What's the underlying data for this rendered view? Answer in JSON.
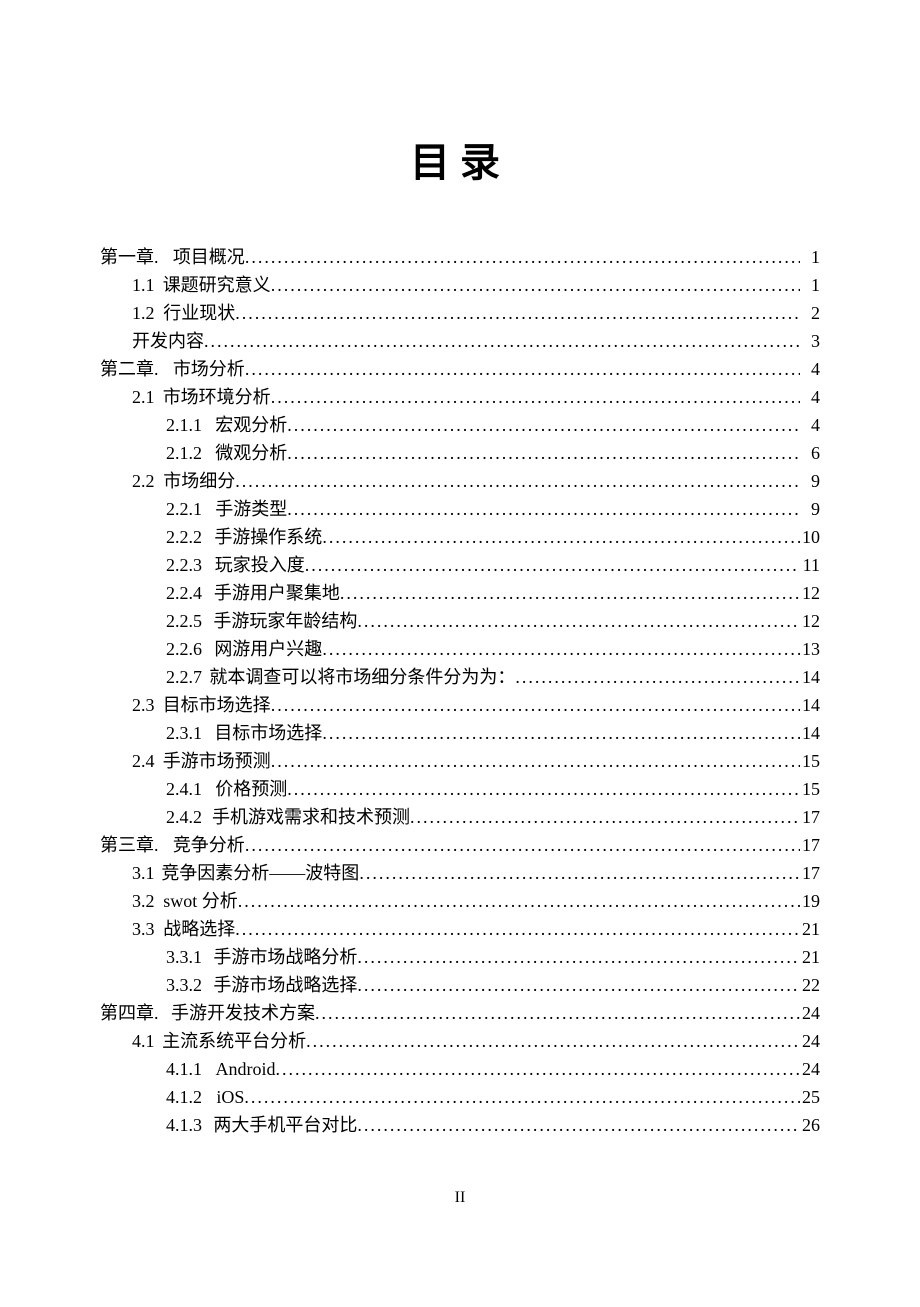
{
  "title": "目录",
  "footer": "II",
  "toc": [
    {
      "level": 0,
      "num": "第一章.",
      "label": "项目概况",
      "page": "1"
    },
    {
      "level": 1,
      "num": "1.1",
      "label": "课题研究意义",
      "page": "1"
    },
    {
      "level": 1,
      "num": "1.2",
      "label": "行业现状",
      "page": "2"
    },
    {
      "level": 1,
      "num": "",
      "label": "开发内容",
      "page": "3"
    },
    {
      "level": 0,
      "num": "第二章.",
      "label": "市场分析",
      "page": "4"
    },
    {
      "level": 1,
      "num": "2.1",
      "label": "市场环境分析",
      "page": "4"
    },
    {
      "level": 2,
      "num": "2.1.1",
      "label": "宏观分析",
      "page": "4"
    },
    {
      "level": 2,
      "num": "2.1.2",
      "label": "微观分析",
      "page": "6"
    },
    {
      "level": 1,
      "num": "2.2",
      "label": "市场细分",
      "page": "9"
    },
    {
      "level": 2,
      "num": "2.2.1",
      "label": "手游类型",
      "page": "9"
    },
    {
      "level": 2,
      "num": "2.2.2",
      "label": "手游操作系统",
      "page": "10"
    },
    {
      "level": 2,
      "num": "2.2.3",
      "label": "玩家投入度",
      "page": "11"
    },
    {
      "level": 2,
      "num": "2.2.4",
      "label": "手游用户聚集地",
      "page": "12"
    },
    {
      "level": 2,
      "num": "2.2.5",
      "label": "手游玩家年龄结构",
      "page": "12"
    },
    {
      "level": 2,
      "num": "2.2.6",
      "label": "网游用户兴趣",
      "page": "13"
    },
    {
      "level": 2,
      "num": "2.2.7",
      "label": "就本调查可以将市场细分条件分为为：",
      "page": "14"
    },
    {
      "level": 1,
      "num": "2.3",
      "label": "目标市场选择",
      "page": "14"
    },
    {
      "level": 2,
      "num": "2.3.1",
      "label": "目标市场选择",
      "page": "14"
    },
    {
      "level": 1,
      "num": "2.4",
      "label": "手游市场预测",
      "page": "15"
    },
    {
      "level": 2,
      "num": "2.4.1",
      "label": "价格预测",
      "page": "15"
    },
    {
      "level": 2,
      "num": "2.4.2",
      "label": "手机游戏需求和技术预测",
      "page": "17"
    },
    {
      "level": 0,
      "num": "第三章.",
      "label": "竞争分析",
      "page": "17"
    },
    {
      "level": 1,
      "num": "3.1",
      "label": "竞争因素分析——波特图",
      "page": "17"
    },
    {
      "level": 1,
      "num": "3.2",
      "label": "swot 分析",
      "page": "19"
    },
    {
      "level": 1,
      "num": "3.3",
      "label": "战略选择",
      "page": "21"
    },
    {
      "level": 2,
      "num": "3.3.1",
      "label": "手游市场战略分析",
      "page": "21"
    },
    {
      "level": 2,
      "num": "3.3.2",
      "label": "手游市场战略选择",
      "page": "22"
    },
    {
      "level": 0,
      "num": "第四章.",
      "label": "手游开发技术方案",
      "page": "24"
    },
    {
      "level": 1,
      "num": "4.1",
      "label": "主流系统平台分析",
      "page": "24"
    },
    {
      "level": 2,
      "num": "4.1.1",
      "label": "Android",
      "page": "24"
    },
    {
      "level": 2,
      "num": "4.1.2",
      "label": "iOS",
      "page": "25"
    },
    {
      "level": 2,
      "num": "4.1.3",
      "label": "两大手机平台对比",
      "page": "26"
    }
  ]
}
